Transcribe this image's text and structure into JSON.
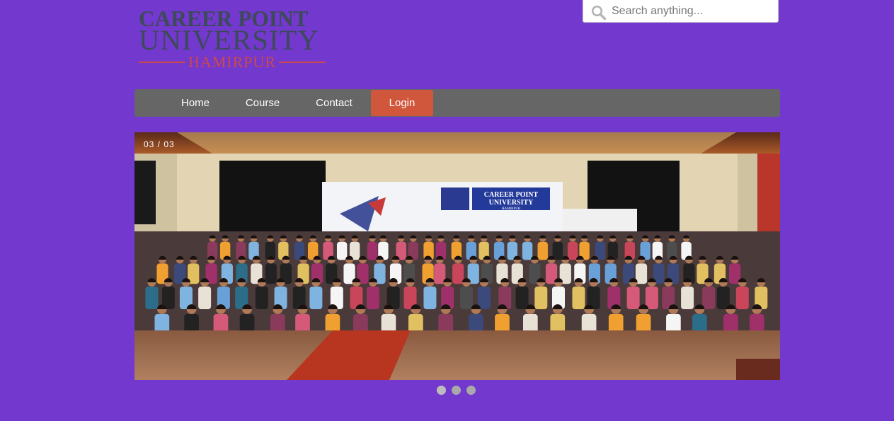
{
  "logo": {
    "line1": "CAREER POINT",
    "line2": "UNIVERSITY",
    "line3": "HAMIRPUR"
  },
  "search": {
    "placeholder": "Search anything..."
  },
  "nav": {
    "items": [
      {
        "label": "Home"
      },
      {
        "label": "Course"
      },
      {
        "label": "Contact"
      },
      {
        "label": "Login",
        "active": true
      }
    ]
  },
  "slider": {
    "counter": "03 / 03",
    "banner_line1": "CAREER POINT",
    "banner_line2": "UNIVERSITY",
    "banner_line3": "HAMIRPUR",
    "slide_count": 3,
    "current_slide": 3
  },
  "colors": {
    "background": "#7338cd",
    "nav_background": "#666666",
    "active_nav": "#d0573c"
  }
}
